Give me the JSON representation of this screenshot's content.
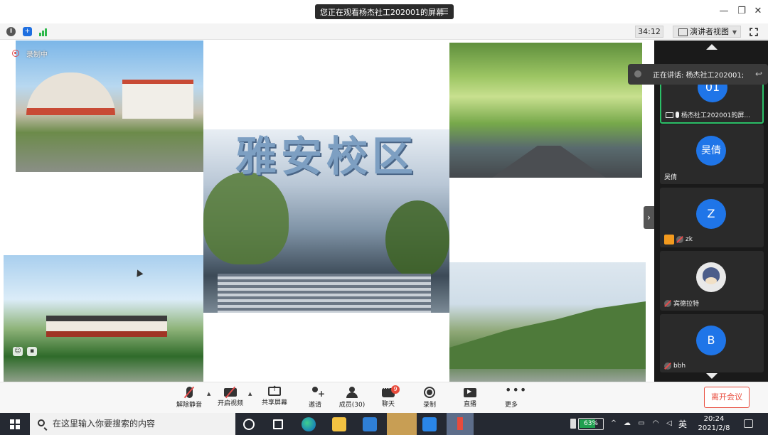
{
  "titlebar": {
    "share_banner": "您正在观看杨杰社工202001的屏幕",
    "minimize": "—",
    "restore": "❐",
    "close": "✕"
  },
  "toolbar": {
    "timer": "34:12",
    "view_mode": "演讲者视图"
  },
  "stage": {
    "recording_label": "录制中",
    "campus_title": "雅安校区"
  },
  "speaking": {
    "text": "正在讲话: 杨杰社工202001;"
  },
  "participants": [
    {
      "avatar": "01",
      "name": "杨杰社工202001的屏...",
      "active": true
    },
    {
      "avatar": "吴倩",
      "name": "吴倩"
    },
    {
      "avatar": "Z",
      "name": "zk"
    },
    {
      "avatar": "",
      "name": "宾德拉特"
    },
    {
      "avatar": "B",
      "name": "bbh"
    }
  ],
  "controls": {
    "unmute": "解除静音",
    "start_video": "开启视频",
    "share_screen": "共享屏幕",
    "invite": "邀请",
    "members": "成员(30)",
    "chat": "聊天",
    "chat_badge": "9",
    "record": "录制",
    "live": "直播",
    "more": "更多",
    "leave": "离开会议"
  },
  "taskbar": {
    "search_placeholder": "在这里输入你要搜索的内容",
    "battery": "63%",
    "language": "英",
    "time": "20:24",
    "date": "2021/2/8"
  },
  "colors": {
    "accent_blue": "#1f75e8",
    "leave_red": "#e84b3c",
    "active_green": "#2bbf67"
  }
}
